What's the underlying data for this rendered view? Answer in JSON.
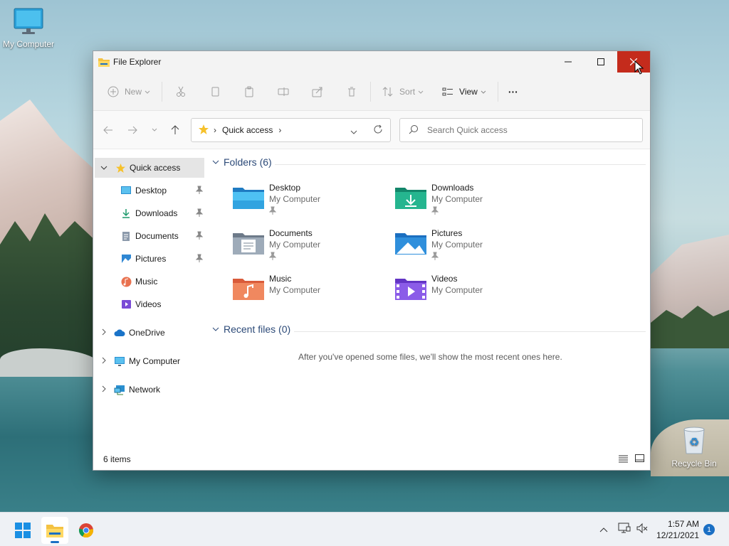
{
  "desktop": {
    "icons": [
      {
        "label": "My Computer"
      },
      {
        "label": "Recycle Bin"
      }
    ]
  },
  "window": {
    "title": "File Explorer",
    "toolbar": {
      "new_label": "New",
      "sort_label": "Sort",
      "view_label": "View",
      "more_label": "···"
    },
    "address": {
      "separator": "›",
      "location": "Quick access",
      "trail": "›"
    },
    "search": {
      "placeholder": "Search Quick access"
    },
    "sidebar": {
      "quick_access": "Quick access",
      "pinned": [
        {
          "label": "Desktop"
        },
        {
          "label": "Downloads"
        },
        {
          "label": "Documents"
        },
        {
          "label": "Pictures"
        },
        {
          "label": "Music"
        },
        {
          "label": "Videos"
        }
      ],
      "onedrive": "OneDrive",
      "my_computer": "My Computer",
      "network": "Network"
    },
    "main": {
      "folders_header": "Folders (6)",
      "folders": [
        {
          "name": "Desktop",
          "location": "My Computer",
          "pinned": true
        },
        {
          "name": "Downloads",
          "location": "My Computer",
          "pinned": true
        },
        {
          "name": "Documents",
          "location": "My Computer",
          "pinned": true
        },
        {
          "name": "Pictures",
          "location": "My Computer",
          "pinned": true
        },
        {
          "name": "Music",
          "location": "My Computer",
          "pinned": false
        },
        {
          "name": "Videos",
          "location": "My Computer",
          "pinned": false
        }
      ],
      "recent_header": "Recent files (0)",
      "recent_empty": "After you've opened some files, we'll show the most recent ones here."
    },
    "status": {
      "item_count": "6 items"
    }
  },
  "taskbar": {
    "time": "1:57 AM",
    "date": "12/21/2021",
    "notification_count": "1"
  },
  "colors": {
    "close_hover": "#c42b1c",
    "accent": "#1a6fc4",
    "header_text": "#2c4a78"
  }
}
